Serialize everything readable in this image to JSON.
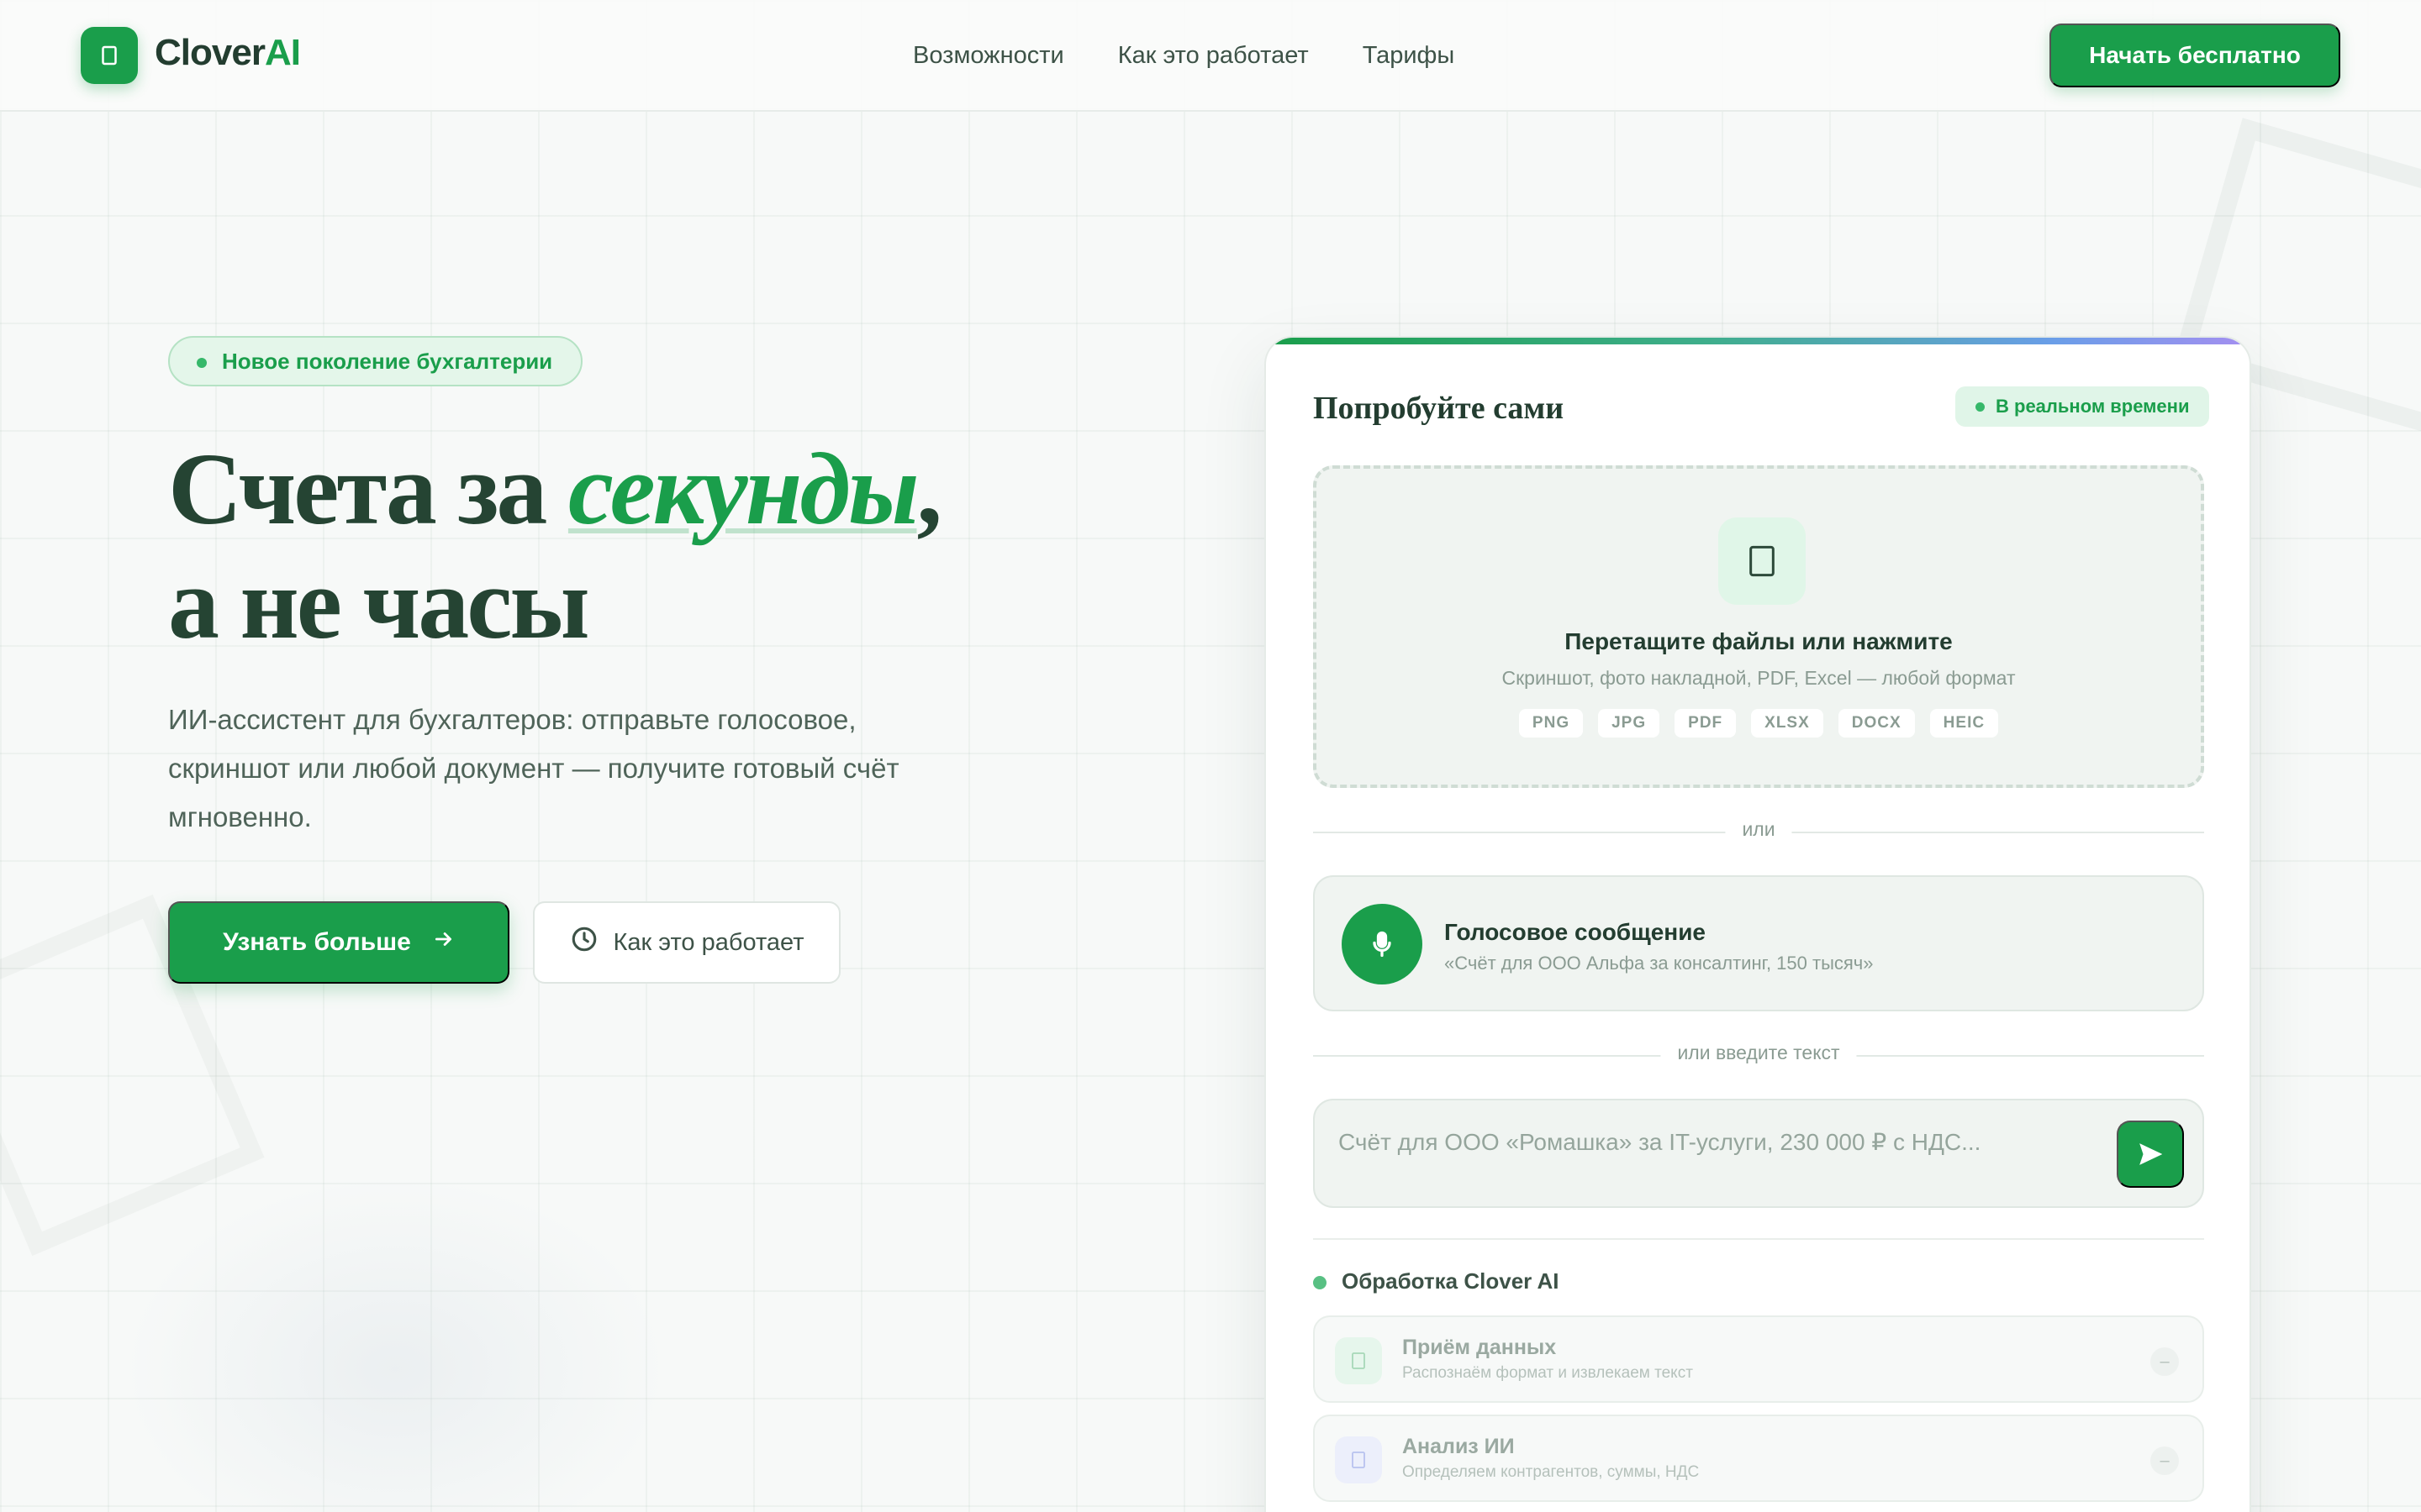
{
  "colors": {
    "brand": "#1a9e4b",
    "text_dark": "#233d30",
    "muted": "#8a9b92"
  },
  "nav": {
    "logo_main": "Clover",
    "logo_accent": "AI",
    "links": [
      "Возможности",
      "Как это работает",
      "Тарифы"
    ],
    "cta": "Начать бесплатно"
  },
  "hero": {
    "badge": "Новое поколение бухгалтерии",
    "title_part1": "Счета за ",
    "title_accent": "секунды",
    "title_comma": ",",
    "title_line2": "а не часы",
    "subtitle": "ИИ-ассистент для бухгалтеров: отправьте голосовое, скриншот или любой документ — получите готовый счёт мгновенно.",
    "primary_button": "Узнать больше",
    "secondary_button": "Как это работает"
  },
  "demo": {
    "title": "Попробуйте сами",
    "realtime_badge": "В реальном времени",
    "dropzone": {
      "title": "Перетащите файлы или нажмите",
      "subtitle": "Скриншот, фото накладной, PDF, Excel — любой формат",
      "formats": [
        "PNG",
        "JPG",
        "PDF",
        "XLSX",
        "DOCX",
        "HEIC"
      ]
    },
    "or_label": "или",
    "voice": {
      "title": "Голосовое сообщение",
      "example": "«Счёт для ООО Альфа за консалтинг, 150 тысяч»"
    },
    "or_text_label": "или введите текст",
    "text_input": {
      "value": "",
      "placeholder": "Счёт для ООО «Ромашка» за IT-услуги, 230 000 ₽ с НДС..."
    },
    "processing": {
      "title": "Обработка Clover AI",
      "steps": [
        {
          "title": "Приём данных",
          "subtitle": "Распознаём формат и извлекаем текст",
          "status": "–",
          "icon": "inbox-icon"
        },
        {
          "title": "Анализ ИИ",
          "subtitle": "Определяем контрагентов, суммы, НДС",
          "status": "–",
          "icon": "sparkle-icon"
        }
      ]
    }
  }
}
